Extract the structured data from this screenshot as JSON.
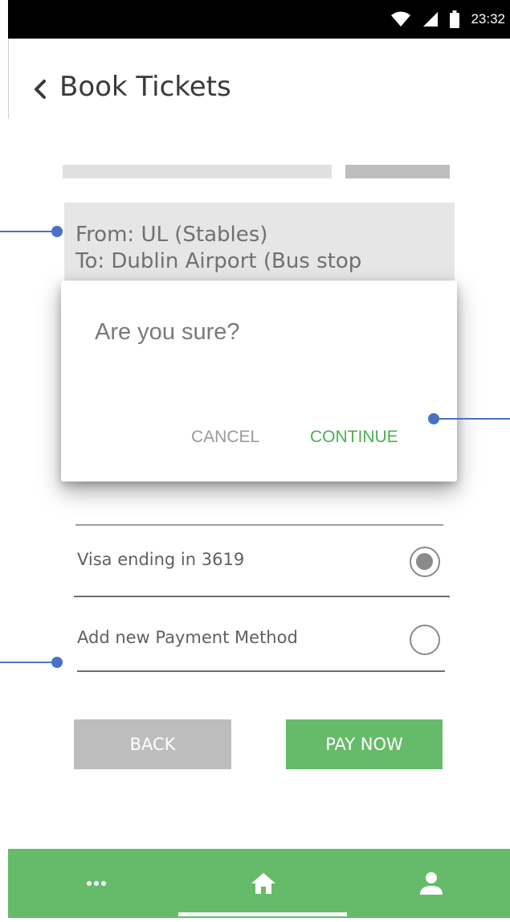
{
  "status_bar": {
    "time": "23:32",
    "icons": [
      "wifi-icon",
      "signal-icon",
      "battery-icon"
    ]
  },
  "header": {
    "title": "Book Tickets",
    "back_icon": "chevron-left-icon"
  },
  "route": {
    "from_line": "From:  UL (Stables)",
    "to_line": "To: Dublin Airport (Bus stop"
  },
  "payment": {
    "methods": [
      {
        "label": "Visa ending in 3619",
        "selected": true
      },
      {
        "label": "Add new Payment Method",
        "selected": false
      }
    ]
  },
  "actions": {
    "back_label": "BACK",
    "pay_label": "PAY NOW"
  },
  "dialog": {
    "title": "Are you sure?",
    "cancel_label": "CANCEL",
    "continue_label": "CONTINUE"
  },
  "bottom_nav": {
    "items": [
      "more-icon",
      "home-icon",
      "profile-icon"
    ]
  },
  "colors": {
    "accent_green": "#66bb6a",
    "dialog_continue": "#4caf50",
    "annotation_blue": "#4a72c4",
    "status_bar": "#000000"
  }
}
